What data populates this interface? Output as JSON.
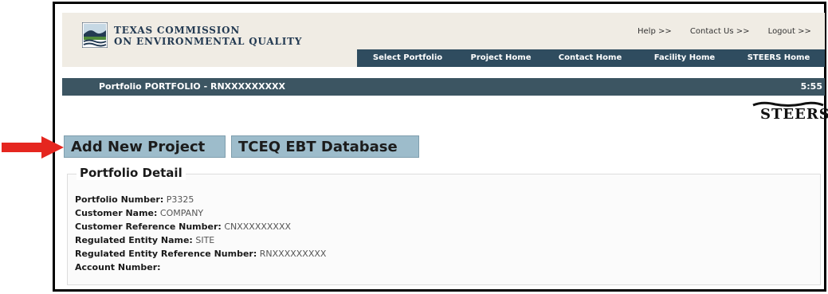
{
  "org": {
    "line1": "Texas Commission",
    "line2": "on Environmental Quality"
  },
  "top_links": [
    "Help >>",
    "Contact Us >>",
    "Logout >>"
  ],
  "nav_tabs": [
    "Select Portfolio",
    "Project Home",
    "Contact Home",
    "Facility Home",
    "STEERS Home"
  ],
  "title_bar": {
    "title": "Portfolio PORTFOLIO - RNXXXXXXXXX",
    "time": "5:55"
  },
  "brand": {
    "steers": "STEERS"
  },
  "buttons": {
    "add_new_project": "Add New Project",
    "tceq_ebt_database": "TCEQ EBT Database"
  },
  "portfolio_detail": {
    "heading": "Portfolio Detail",
    "rows": [
      {
        "label": "Portfolio Number:",
        "value": "P3325"
      },
      {
        "label": "Customer Name:",
        "value": "COMPANY"
      },
      {
        "label": "Customer Reference Number:",
        "value": "CNXXXXXXXXX"
      },
      {
        "label": "Regulated Entity Name:",
        "value": "SITE"
      },
      {
        "label": "Regulated Entity Reference Number:",
        "value": "RNXXXXXXXXX"
      },
      {
        "label": "Account Number:",
        "value": ""
      }
    ]
  },
  "colors": {
    "nav_bg": "#2f4c5f",
    "title_bg": "#3c5562",
    "button_bg": "#9dbccb",
    "arrow": "#e5261f"
  }
}
